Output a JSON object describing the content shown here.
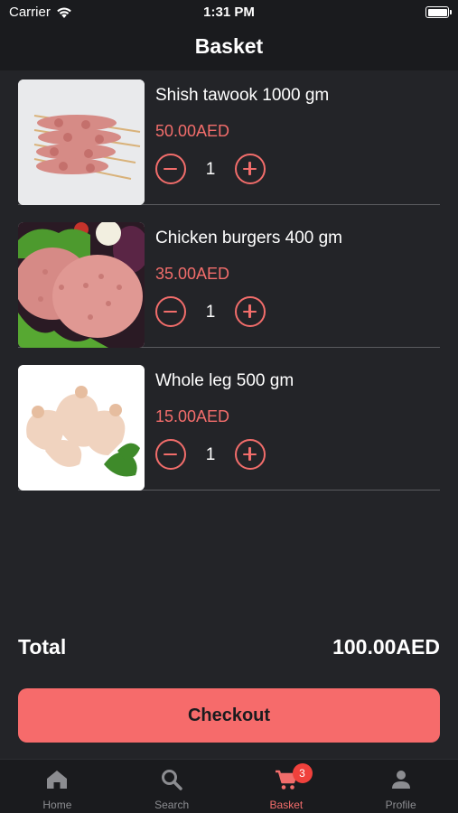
{
  "status_bar": {
    "carrier": "Carrier",
    "time": "1:31 PM"
  },
  "header": {
    "title": "Basket"
  },
  "items": [
    {
      "name": "Shish tawook 1000 gm",
      "price": "50.00AED",
      "quantity": "1",
      "image_icon": "shish-tawook-image"
    },
    {
      "name": "Chicken burgers 400 gm",
      "price": "35.00AED",
      "quantity": "1",
      "image_icon": "chicken-burger-image"
    },
    {
      "name": "Whole leg 500 gm",
      "price": "15.00AED",
      "quantity": "1",
      "image_icon": "chicken-leg-image"
    }
  ],
  "summary": {
    "total_label": "Total",
    "total_value": "100.00AED"
  },
  "checkout": {
    "label": "Checkout"
  },
  "tab_bar": {
    "tabs": [
      {
        "label": "Home",
        "icon": "home-icon"
      },
      {
        "label": "Search",
        "icon": "search-icon"
      },
      {
        "label": "Basket",
        "icon": "cart-icon",
        "badge": "3",
        "active": true
      },
      {
        "label": "Profile",
        "icon": "person-icon"
      }
    ]
  },
  "colors": {
    "background": "#232428",
    "bar_background": "#1a1b1e",
    "accent": "#f26d6b",
    "checkout_button": "#f66b6b",
    "badge": "#f0413c",
    "inactive_tab": "#8c8d91"
  }
}
